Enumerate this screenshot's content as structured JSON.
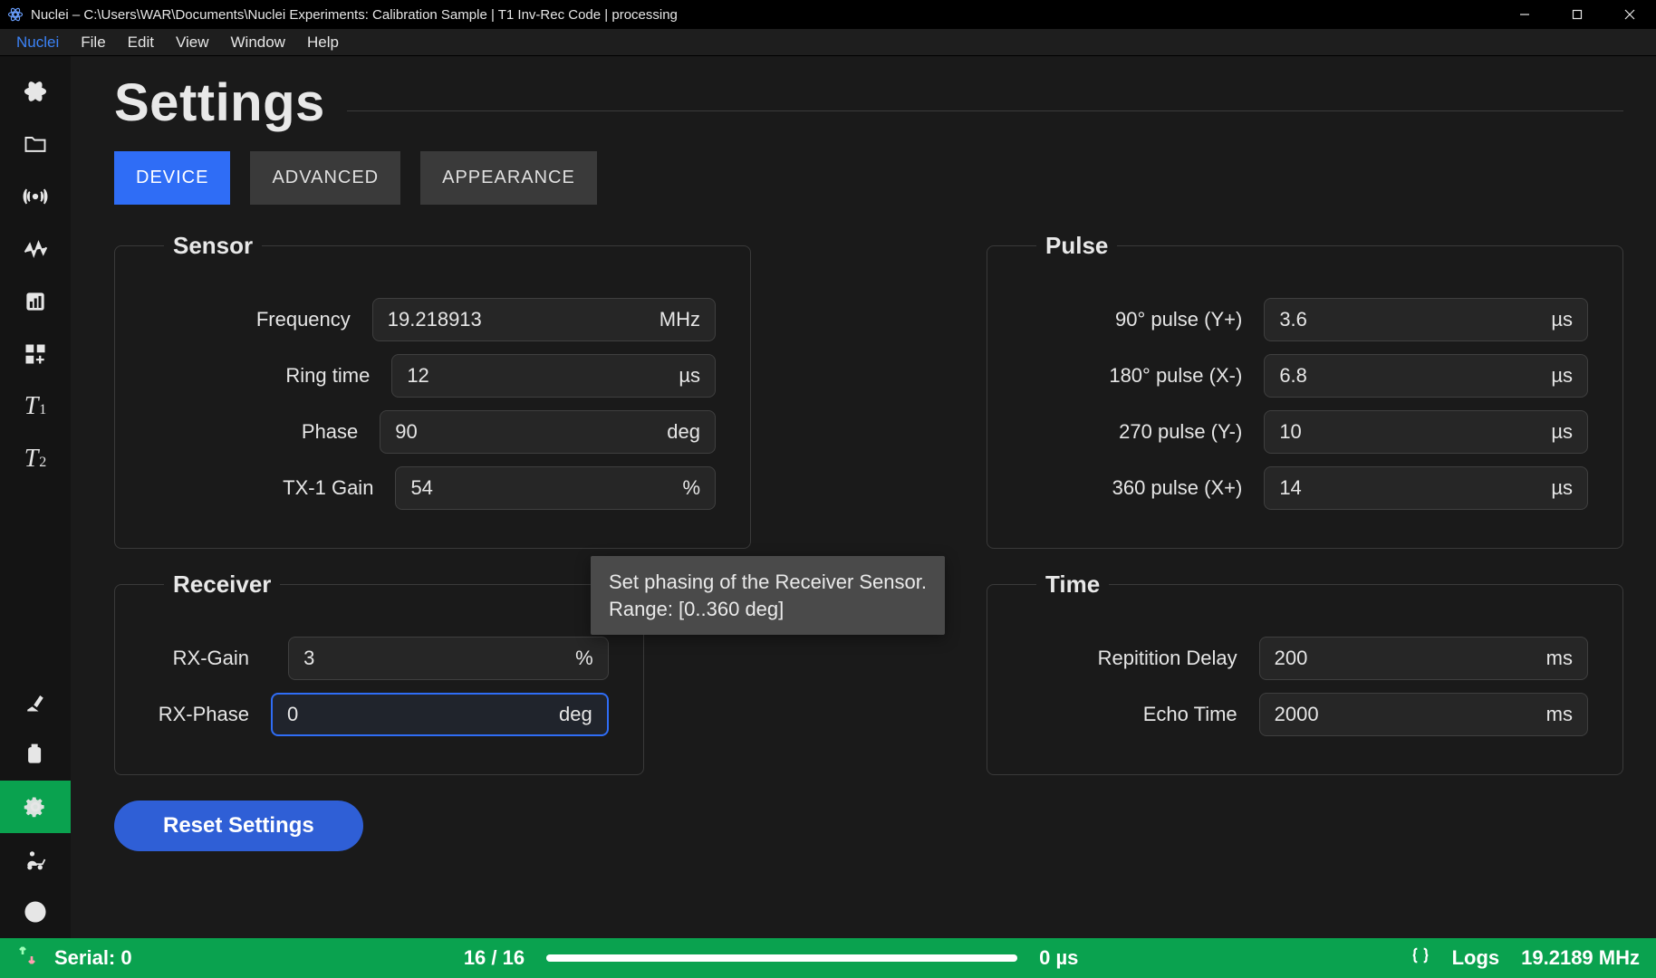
{
  "titlebar": {
    "text": "Nuclei – C:\\Users\\WAR\\Documents\\Nuclei Experiments: Calibration Sample | T1 Inv-Rec Code | processing"
  },
  "menubar": [
    "Nuclei",
    "File",
    "Edit",
    "View",
    "Window",
    "Help"
  ],
  "page_title": "Settings",
  "tabs": [
    {
      "label": "DEVICE",
      "active": true
    },
    {
      "label": "ADVANCED",
      "active": false
    },
    {
      "label": "APPEARANCE",
      "active": false
    }
  ],
  "groups": {
    "sensor": {
      "legend": "Sensor",
      "rows": [
        {
          "label": "Frequency",
          "value": "19.218913",
          "unit": "MHz"
        },
        {
          "label": "Ring time",
          "value": "12",
          "unit": "µs"
        },
        {
          "label": "Phase",
          "value": "90",
          "unit": "deg"
        },
        {
          "label": "TX-1 Gain",
          "value": "54",
          "unit": "%"
        }
      ]
    },
    "pulse": {
      "legend": "Pulse",
      "rows": [
        {
          "label": "90° pulse (Y+)",
          "value": "3.6",
          "unit": "µs"
        },
        {
          "label": "180° pulse (X-)",
          "value": "6.8",
          "unit": "µs"
        },
        {
          "label": "270 pulse (Y-)",
          "value": "10",
          "unit": "µs"
        },
        {
          "label": "360 pulse (X+)",
          "value": "14",
          "unit": "µs"
        }
      ]
    },
    "receiver": {
      "legend": "Receiver",
      "rows": [
        {
          "label": "RX-Gain",
          "value": "3",
          "unit": "%"
        },
        {
          "label": "RX-Phase",
          "value": "0",
          "unit": "deg",
          "focused": true
        }
      ]
    },
    "time": {
      "legend": "Time",
      "rows": [
        {
          "label": "Repitition Delay",
          "value": "200",
          "unit": "ms"
        },
        {
          "label": "Echo Time",
          "value": "2000",
          "unit": "ms"
        }
      ]
    }
  },
  "tooltip": {
    "line1": "Set phasing of the Receiver Sensor.",
    "line2": "Range: [0..360 deg]"
  },
  "reset_label": "Reset Settings",
  "statusbar": {
    "serial_label": "Serial: 0",
    "progress_text": "16 / 16",
    "time_text": "0 µs",
    "logs_label": "Logs",
    "freq_label": "19.2189 MHz"
  }
}
